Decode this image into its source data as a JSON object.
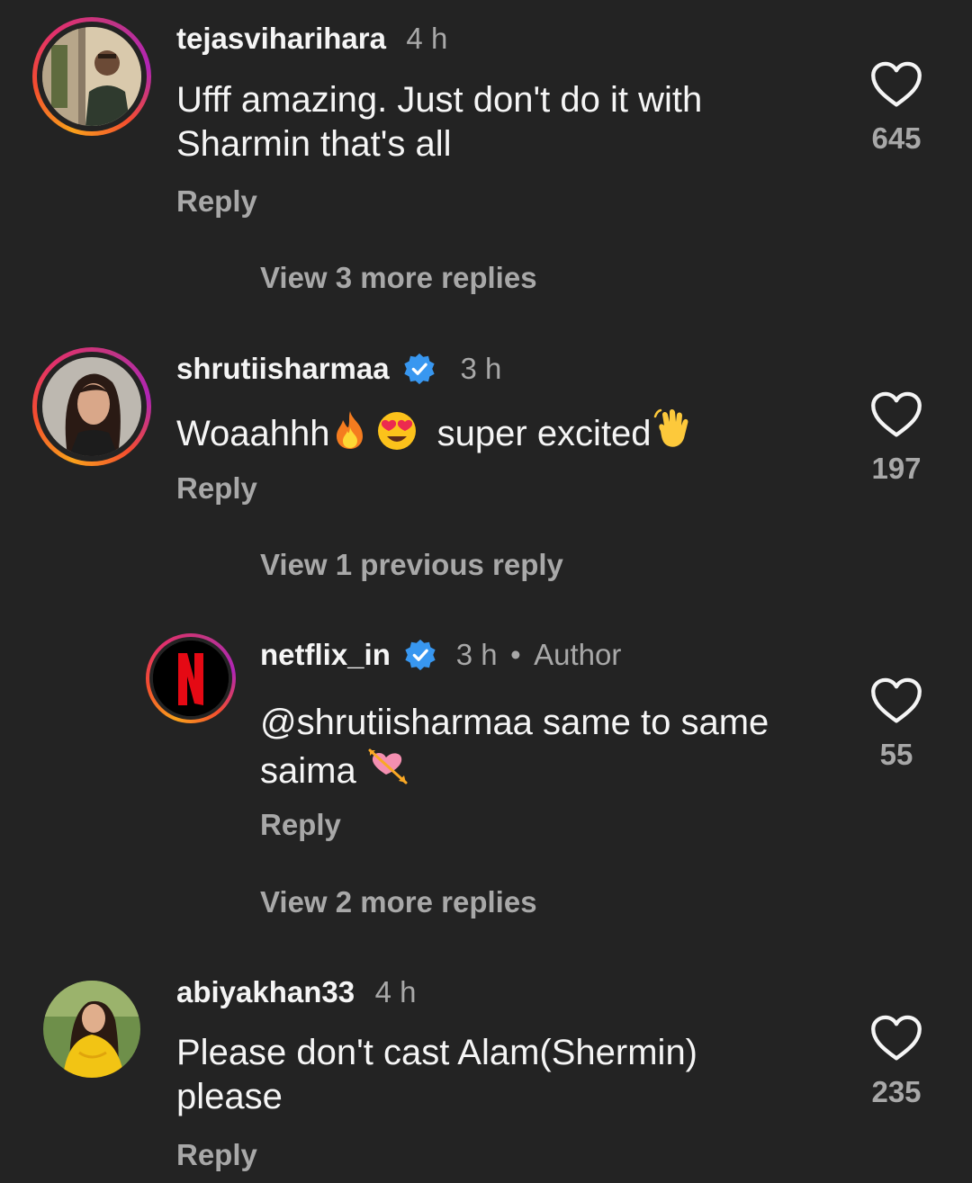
{
  "comments": [
    {
      "username": "tejasviharihara",
      "time": "4 h",
      "text_line1": "Ufff amazing. Just don't do it with",
      "text_line2": "Sharmin that's all",
      "reply": "Reply",
      "likes": "645",
      "view_more": "View 3 more replies"
    },
    {
      "username": "shrutiisharmaa",
      "time": "3 h",
      "text_a": "Woaahhh",
      "text_b": "super excited",
      "reply": "Reply",
      "likes": "197",
      "view_more": "View 1 previous reply"
    },
    {
      "username": "netflix_in",
      "time": "3 h",
      "author_label": "Author",
      "text_line1": "@shrutiisharmaa same to same",
      "text_line2": "saima",
      "reply": "Reply",
      "likes": "55",
      "view_more": "View 2 more replies"
    },
    {
      "username": "abiyakhan33",
      "time": "4 h",
      "text_line1": "Please don't cast Alam(Shermin)",
      "text_line2": "please",
      "reply": "Reply",
      "likes": "235"
    }
  ],
  "icons": {
    "like": "heart-outline-icon",
    "verified": "verified-badge-icon",
    "fire": "fire-emoji",
    "heart_eyes": "heart-eyes-emoji",
    "clap": "waving-hand-emoji",
    "heart_arrow": "heart-with-arrow-emoji"
  },
  "colors": {
    "background": "#232323",
    "primary_text": "#f5f5f5",
    "secondary_text": "#a8a8a8",
    "verified_blue": "#3897f0",
    "netflix_red": "#e50914"
  }
}
